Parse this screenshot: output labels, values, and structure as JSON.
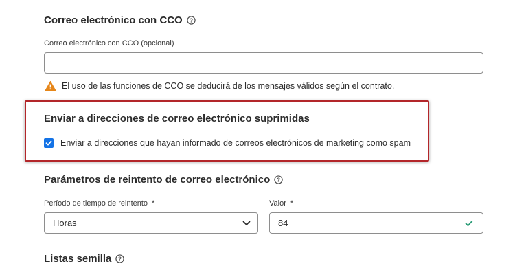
{
  "bcc_section": {
    "title": "Correo electrónico con CCO",
    "field_label": "Correo electrónico con CCO (opcional)",
    "field_value": "",
    "field_placeholder": "",
    "warning_text": "El uso de las funciones de CCO se deducirá de los mensajes válidos según el contrato."
  },
  "suppressed_section": {
    "title": "Enviar a direcciones de correo electrónico suprimidas",
    "checkbox_label": "Enviar a direcciones que hayan informado de correos electrónicos de marketing como spam",
    "checked": true
  },
  "retry_section": {
    "title": "Parámetros de reintento de correo electrónico",
    "period_label": "Período de tiempo de reintento",
    "period_value": "Horas",
    "value_label": "Valor",
    "value": "84",
    "required_mark": "*"
  },
  "seed_section": {
    "title": "Listas semilla"
  },
  "colors": {
    "accent": "#1473e6",
    "warning": "#e68619",
    "highlight": "#b3262a",
    "valid": "#2d9d78"
  }
}
